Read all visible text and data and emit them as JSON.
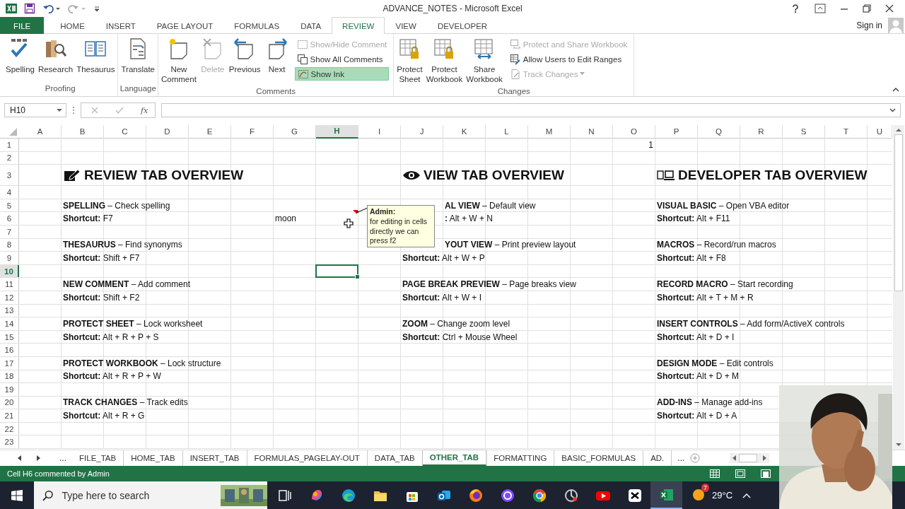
{
  "window": {
    "title": "ADVANCE_NOTES - Microsoft Excel"
  },
  "ribbon_tabs": [
    {
      "label": "FILE",
      "kind": "file",
      "selected": false
    },
    {
      "label": "HOME",
      "kind": "tab",
      "selected": false
    },
    {
      "label": "INSERT",
      "kind": "tab",
      "selected": false
    },
    {
      "label": "PAGE LAYOUT",
      "kind": "tab",
      "selected": false
    },
    {
      "label": "FORMULAS",
      "kind": "tab",
      "selected": false
    },
    {
      "label": "DATA",
      "kind": "tab",
      "selected": false
    },
    {
      "label": "REVIEW",
      "kind": "tab",
      "selected": true
    },
    {
      "label": "VIEW",
      "kind": "tab",
      "selected": false
    },
    {
      "label": "DEVELOPER",
      "kind": "tab",
      "selected": false
    }
  ],
  "account": {
    "label": "Sign in"
  },
  "ribbon_groups": [
    {
      "label": "Proofing",
      "large_buttons": [
        {
          "lines": [
            "Spelling"
          ],
          "disabled": false
        },
        {
          "lines": [
            "Research"
          ],
          "disabled": false
        },
        {
          "lines": [
            "Thesaurus"
          ],
          "disabled": false
        }
      ]
    },
    {
      "label": "Language",
      "large_buttons": [
        {
          "lines": [
            "Translate"
          ],
          "disabled": false
        }
      ]
    },
    {
      "label": "Comments",
      "large_buttons": [
        {
          "lines": [
            "New",
            "Comment"
          ],
          "disabled": false
        },
        {
          "lines": [
            "Delete"
          ],
          "disabled": true
        },
        {
          "lines": [
            "Previous"
          ],
          "disabled": false
        },
        {
          "lines": [
            "Next"
          ],
          "disabled": false
        }
      ],
      "small_buttons": [
        {
          "label": "Show/Hide Comment",
          "disabled": true,
          "selected": false,
          "dropdown": false
        },
        {
          "label": "Show All Comments",
          "disabled": false,
          "selected": false,
          "dropdown": false
        },
        {
          "label": "Show Ink",
          "disabled": false,
          "selected": true,
          "dropdown": false
        }
      ]
    },
    {
      "label": "Changes",
      "large_buttons": [
        {
          "lines": [
            "Protect",
            "Sheet"
          ],
          "disabled": false
        },
        {
          "lines": [
            "Protect",
            "Workbook"
          ],
          "disabled": false
        },
        {
          "lines": [
            "Share",
            "Workbook"
          ],
          "disabled": false
        }
      ],
      "small_buttons": [
        {
          "label": "Protect and Share Workbook",
          "disabled": true,
          "selected": false,
          "dropdown": false
        },
        {
          "label": "Allow Users to Edit Ranges",
          "disabled": false,
          "selected": false,
          "dropdown": false
        },
        {
          "label": "Track Changes",
          "disabled": true,
          "selected": false,
          "dropdown": true
        }
      ]
    }
  ],
  "formula_bar": {
    "name_box": "H10",
    "function_label": "fx"
  },
  "sheet": {
    "columns": [
      {
        "label": "A",
        "selected": false
      },
      {
        "label": "B",
        "selected": false
      },
      {
        "label": "C",
        "selected": false
      },
      {
        "label": "D",
        "selected": false
      },
      {
        "label": "E",
        "selected": false
      },
      {
        "label": "F",
        "selected": false
      },
      {
        "label": "G",
        "selected": false
      },
      {
        "label": "H",
        "selected": true
      },
      {
        "label": "I",
        "selected": false
      },
      {
        "label": "J",
        "selected": false
      },
      {
        "label": "K",
        "selected": false
      },
      {
        "label": "L",
        "selected": false
      },
      {
        "label": "M",
        "selected": false
      },
      {
        "label": "N",
        "selected": false
      },
      {
        "label": "O",
        "selected": false
      },
      {
        "label": "P",
        "selected": false
      },
      {
        "label": "Q",
        "selected": false
      },
      {
        "label": "R",
        "selected": false
      },
      {
        "label": "S",
        "selected": false
      },
      {
        "label": "T",
        "selected": false
      },
      {
        "label": "U",
        "selected": false
      }
    ],
    "rows": [
      {
        "number": "1",
        "selected": false,
        "kind": "number",
        "cells": [
          "",
          "",
          "",
          "",
          "",
          "",
          "",
          "",
          "",
          "",
          "",
          "",
          "",
          "",
          "1"
        ]
      },
      {
        "number": "2",
        "selected": false,
        "kind": "text"
      },
      {
        "number": "3",
        "selected": false,
        "kind": "heading",
        "cells": [
          "",
          "REVIEW TAB OVERVIEW",
          "",
          "",
          "",
          "",
          "",
          "",
          "",
          "VIEW TAB OVERVIEW",
          "",
          "",
          "",
          "",
          "",
          "DEVELOPER TAB OVERVIEW"
        ]
      },
      {
        "number": "4",
        "selected": false,
        "kind": "text"
      },
      {
        "number": "5",
        "selected": false,
        "kind": "text",
        "cells": [
          "",
          "**SPELLING** – Check spelling",
          "",
          "",
          "",
          "",
          "",
          "",
          "",
          "",
          "**AL VIEW** – Default view",
          "",
          "",
          "",
          "",
          "**VISUAL BASIC** – Open VBA editor"
        ]
      },
      {
        "number": "6",
        "selected": false,
        "kind": "text",
        "cells": [
          "",
          "**Shortcut:** F7",
          "",
          "",
          "",
          "",
          "moon",
          "",
          "",
          "",
          "**:** Alt + W + N",
          "",
          "",
          "",
          "",
          "**Shortcut:** Alt + F11"
        ]
      },
      {
        "number": "7",
        "selected": false,
        "kind": "text"
      },
      {
        "number": "8",
        "selected": false,
        "kind": "text",
        "cells": [
          "",
          "**THESAURUS** – Find synonyms",
          "",
          "",
          "",
          "",
          "",
          "",
          "",
          "",
          "**YOUT VIEW** – Print preview layout",
          "",
          "",
          "",
          "",
          "**MACROS** – Record/run macros"
        ]
      },
      {
        "number": "9",
        "selected": false,
        "kind": "text",
        "cells": [
          "",
          "**Shortcut:** Shift + F7",
          "",
          "",
          "",
          "",
          "",
          "",
          "",
          "**Shortcut:** Alt + W + P",
          "",
          "",
          "",
          "",
          "",
          "**Shortcut:** Alt + F8"
        ]
      },
      {
        "number": "10",
        "selected": true,
        "kind": "text"
      },
      {
        "number": "11",
        "selected": false,
        "kind": "text",
        "cells": [
          "",
          "**NEW COMMENT** – Add comment",
          "",
          "",
          "",
          "",
          "",
          "",
          "",
          "**PAGE BREAK PREVIEW** – Page breaks view",
          "",
          "",
          "",
          "",
          "",
          "**RECORD MACRO** – Start recording"
        ]
      },
      {
        "number": "12",
        "selected": false,
        "kind": "text",
        "cells": [
          "",
          "**Shortcut:** Shift + F2",
          "",
          "",
          "",
          "",
          "",
          "",
          "",
          "**Shortcut:** Alt + W + I",
          "",
          "",
          "",
          "",
          "",
          "**Shortcut:** Alt + T + M + R"
        ]
      },
      {
        "number": "13",
        "selected": false,
        "kind": "text"
      },
      {
        "number": "14",
        "selected": false,
        "kind": "text",
        "cells": [
          "",
          "**PROTECT SHEET** – Lock worksheet",
          "",
          "",
          "",
          "",
          "",
          "",
          "",
          "**ZOOM** – Change zoom level",
          "",
          "",
          "",
          "",
          "",
          "**INSERT CONTROLS** – Add form/ActiveX controls"
        ]
      },
      {
        "number": "15",
        "selected": false,
        "kind": "text",
        "cells": [
          "",
          "**Shortcut:** Alt + R + P + S",
          "",
          "",
          "",
          "",
          "",
          "",
          "",
          "**Shortcut:** Ctrl + Mouse Wheel",
          "",
          "",
          "",
          "",
          "",
          "**Shortcut:** Alt + D + I"
        ]
      },
      {
        "number": "16",
        "selected": false,
        "kind": "text"
      },
      {
        "number": "17",
        "selected": false,
        "kind": "text",
        "cells": [
          "",
          "**PROTECT WORKBOOK** – Lock structure",
          "",
          "",
          "",
          "",
          "",
          "",
          "",
          "",
          "",
          "",
          "",
          "",
          "",
          "**DESIGN MODE** – Edit controls"
        ]
      },
      {
        "number": "18",
        "selected": false,
        "kind": "text",
        "cells": [
          "",
          "**Shortcut:** Alt + R + P + W",
          "",
          "",
          "",
          "",
          "",
          "",
          "",
          "",
          "",
          "",
          "",
          "",
          "",
          "**Shortcut:** Alt + D + M"
        ]
      },
      {
        "number": "19",
        "selected": false,
        "kind": "text"
      },
      {
        "number": "20",
        "selected": false,
        "kind": "text",
        "cells": [
          "",
          "**TRACK CHANGES** – Track edits",
          "",
          "",
          "",
          "",
          "",
          "",
          "",
          "",
          "",
          "",
          "",
          "",
          "",
          "**ADD-INS** – Manage add-ins"
        ]
      },
      {
        "number": "21",
        "selected": false,
        "kind": "text",
        "cells": [
          "",
          "**Shortcut:** Alt + R + G",
          "",
          "",
          "",
          "",
          "",
          "",
          "",
          "",
          "",
          "",
          "",
          "",
          "",
          "**Shortcut:** Alt + D + A"
        ]
      },
      {
        "number": "22",
        "selected": false,
        "kind": "text"
      },
      {
        "number": "23",
        "selected": false,
        "kind": "text"
      }
    ]
  },
  "comment": {
    "author": "Admin:",
    "text": "for editing in cells directly we can press f2"
  },
  "sheet_tabs": {
    "more_left": "...",
    "more_right": "...",
    "tabs": [
      {
        "label": "FILE_TAB",
        "selected": false
      },
      {
        "label": "HOME_TAB",
        "selected": false
      },
      {
        "label": "INSERT_TAB",
        "selected": false
      },
      {
        "label": "FORMULAS_PAGELAY-OUT",
        "selected": false
      },
      {
        "label": "DATA_TAB",
        "selected": false
      },
      {
        "label": "OTHER_TAB",
        "selected": true
      },
      {
        "label": "FORMATTING",
        "selected": false
      },
      {
        "label": "BASIC_FORMULAS",
        "selected": false
      },
      {
        "label": "AD.",
        "selected": false
      }
    ]
  },
  "status_bar": {
    "text": "Cell H6 commented by Admin"
  },
  "taskbar": {
    "search_placeholder": "Type here to search",
    "weather_badge": "7",
    "temperature": "29°C",
    "apps": [
      {
        "selected": false
      },
      {
        "selected": false
      },
      {
        "selected": false
      },
      {
        "selected": false
      },
      {
        "selected": false
      },
      {
        "selected": false
      },
      {
        "selected": false
      },
      {
        "selected": false
      },
      {
        "selected": false
      },
      {
        "selected": false
      },
      {
        "selected": false
      },
      {
        "selected": false
      },
      {
        "selected": true
      }
    ]
  }
}
